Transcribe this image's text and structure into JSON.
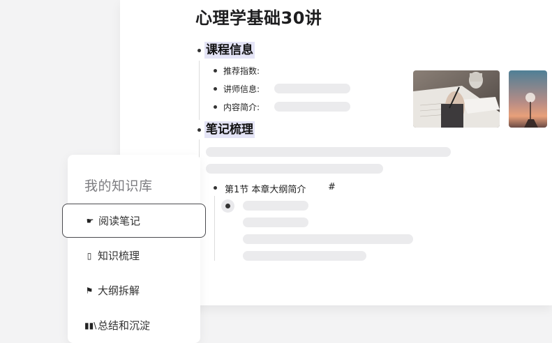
{
  "doc": {
    "title": "心理学基础30讲",
    "sections": [
      {
        "title": "课程信息",
        "items": [
          {
            "label": "推荐指数:"
          },
          {
            "label": "讲师信息:"
          },
          {
            "label": "内容简介:"
          }
        ]
      },
      {
        "title": "笔记梳理",
        "chapter": {
          "label": "第1节 本章大纲简介",
          "hash": "#"
        }
      }
    ],
    "images": [
      "writing-notes-photo",
      "dandelion-sunset-photo"
    ]
  },
  "menu": {
    "title": "我的知识库",
    "items": [
      {
        "label": "阅读笔记",
        "icon": "pointing-hand-icon",
        "active": true
      },
      {
        "label": "知识梳理",
        "icon": "page-icon",
        "active": false
      },
      {
        "label": "大纲拆解",
        "icon": "flag-icon",
        "active": false
      },
      {
        "label": "总结和沉淀",
        "icon": "books-icon",
        "active": false
      }
    ]
  }
}
